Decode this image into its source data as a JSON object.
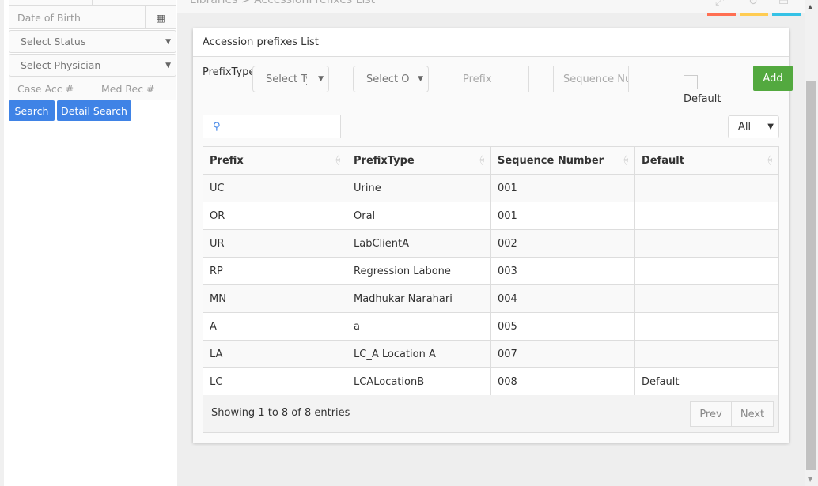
{
  "sidebar": {
    "dob_placeholder": "Date of Birth",
    "status_select": "Select Status",
    "physician_select": "Select Physician",
    "case_acc_placeholder": "Case Acc #",
    "med_rec_placeholder": "Med Rec #",
    "search_button": "Search",
    "detail_search_button": "Detail Search"
  },
  "header": {
    "breadcrumb": "Libraries > AccessionPrefixes List",
    "accent_colors": [
      "#ff6f52",
      "#ffcc52",
      "#35c2e6"
    ]
  },
  "panel": {
    "title": "Accession prefixes List",
    "prefix_type_label": "PrefixType",
    "select_type": "Select Type",
    "select_other": "Select O",
    "prefix_placeholder": "Prefix",
    "sequence_placeholder": "Sequence Number",
    "default_label": "Default",
    "default_checked": false,
    "add_button": "Add",
    "length_select": "All",
    "columns": [
      "Prefix",
      "PrefixType",
      "Sequence Number",
      "Default"
    ],
    "rows": [
      [
        "UC",
        "Urine",
        "001",
        ""
      ],
      [
        "OR",
        "Oral",
        "001",
        ""
      ],
      [
        "UR",
        "LabClientA",
        "002",
        ""
      ],
      [
        "RP",
        "Regression Labone",
        "003",
        ""
      ],
      [
        "MN",
        "Madhukar Narahari",
        "004",
        ""
      ],
      [
        "A",
        "a",
        "005",
        ""
      ],
      [
        "LA",
        "LC_A Location A",
        "007",
        ""
      ],
      [
        "LC",
        "LCALocationB",
        "008",
        "Default"
      ]
    ],
    "info": "Showing 1 to 8 of 8 entries",
    "prev": "Prev",
    "next": "Next"
  }
}
